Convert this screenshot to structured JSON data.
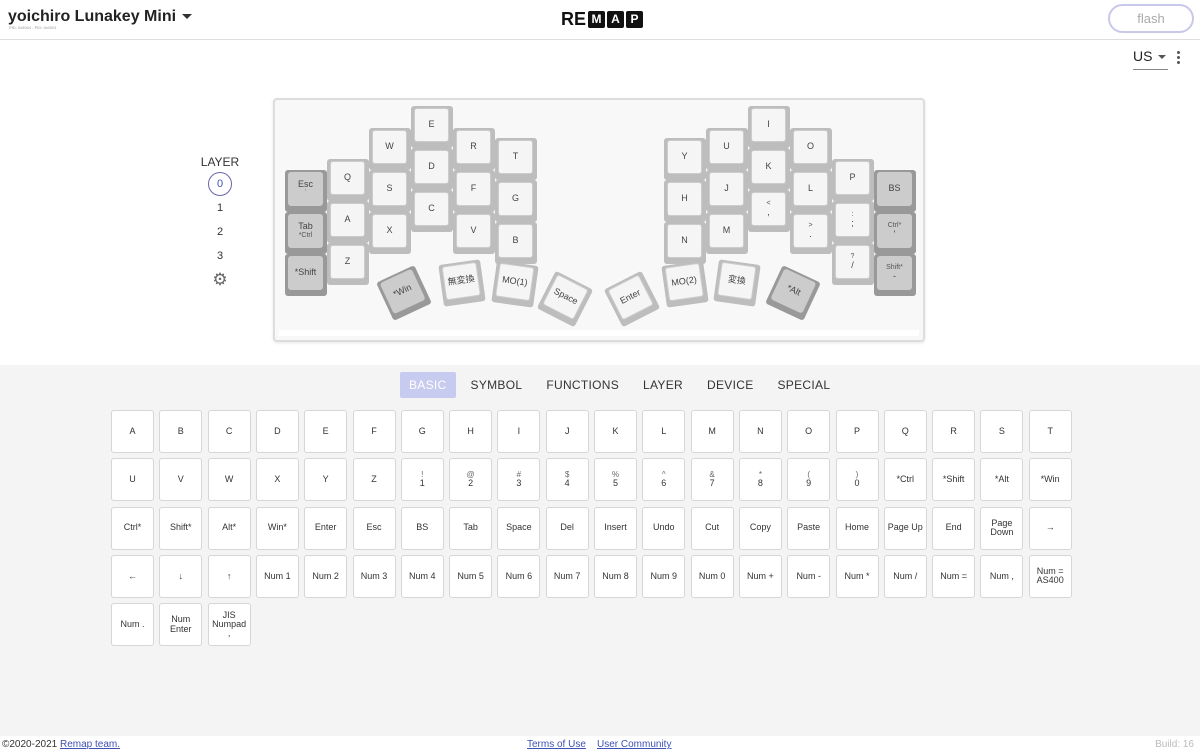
{
  "header": {
    "keyboard_name": "yoichiro Lunakey Mini",
    "ids": "PID: 0x5904 - PID: 0x0001",
    "logo_text": "RE",
    "logo_boxes": [
      "M",
      "A",
      "P"
    ],
    "flash_label": "flash"
  },
  "lang": {
    "value": "US"
  },
  "layer": {
    "title": "LAYER",
    "items": [
      "0",
      "1",
      "2",
      "3"
    ],
    "selected": "0"
  },
  "keymap": [
    {
      "l": "Esc",
      "s": "`",
      "mod": true
    },
    {
      "l": "Tab",
      "s": "*Ctrl",
      "mod": true
    },
    {
      "l": "*Shift",
      "s": "",
      "mod": true
    },
    {
      "l": "Q",
      "s": ""
    },
    {
      "l": "A",
      "s": ""
    },
    {
      "l": "Z",
      "s": ""
    },
    {
      "l": "W",
      "s": ""
    },
    {
      "l": "S",
      "s": ""
    },
    {
      "l": "X",
      "s": ""
    },
    {
      "l": "E",
      "s": ""
    },
    {
      "l": "D",
      "s": ""
    },
    {
      "l": "C",
      "s": ""
    },
    {
      "l": "R",
      "s": ""
    },
    {
      "l": "F",
      "s": ""
    },
    {
      "l": "V",
      "s": ""
    },
    {
      "l": "T",
      "s": ""
    },
    {
      "l": "G",
      "s": ""
    },
    {
      "l": "B",
      "s": ""
    },
    {
      "l": "Y",
      "s": ""
    },
    {
      "l": "H",
      "s": ""
    },
    {
      "l": "N",
      "s": ""
    },
    {
      "l": "U",
      "s": ""
    },
    {
      "l": "J",
      "s": ""
    },
    {
      "l": "M",
      "s": ""
    },
    {
      "l": "I",
      "s": ""
    },
    {
      "l": "K",
      "s": ""
    },
    {
      "l": ",",
      "s": "<"
    },
    {
      "l": "O",
      "s": ""
    },
    {
      "l": "L",
      "s": ""
    },
    {
      "l": ".",
      "s": ">"
    },
    {
      "l": "P",
      "s": ""
    },
    {
      "l": ";",
      "s": ":"
    },
    {
      "l": "/",
      "s": "?"
    },
    {
      "l": "BS",
      "s": "",
      "mod": true
    },
    {
      "l": "'",
      "s": "Ctrl*",
      "mod": true
    },
    {
      "l": "-",
      "s": "Shift*",
      "mod": true
    },
    {
      "l": "*Win",
      "s": "",
      "mod": true
    },
    {
      "l": "無変換",
      "s": ""
    },
    {
      "l": "MO(1)",
      "s": ""
    },
    {
      "l": "Space",
      "s": ""
    },
    {
      "l": "Enter",
      "s": ""
    },
    {
      "l": "MO(2)",
      "s": ""
    },
    {
      "l": "変換",
      "s": ""
    },
    {
      "l": "*Alt",
      "s": "",
      "mod": true
    }
  ],
  "palette": {
    "tabs": [
      "BASIC",
      "SYMBOL",
      "FUNCTIONS",
      "LAYER",
      "DEVICE",
      "SPECIAL"
    ],
    "active_tab": "BASIC",
    "rows": [
      [
        {
          "l": "A"
        },
        {
          "l": "B"
        },
        {
          "l": "C"
        },
        {
          "l": "D"
        },
        {
          "l": "E"
        },
        {
          "l": "F"
        },
        {
          "l": "G"
        },
        {
          "l": "H"
        },
        {
          "l": "I"
        },
        {
          "l": "J"
        },
        {
          "l": "K"
        },
        {
          "l": "L"
        },
        {
          "l": "M"
        },
        {
          "l": "N"
        },
        {
          "l": "O"
        },
        {
          "l": "P"
        },
        {
          "l": "Q"
        },
        {
          "l": "R"
        },
        {
          "l": "S"
        },
        {
          "l": "T"
        }
      ],
      [
        {
          "l": "U"
        },
        {
          "l": "V"
        },
        {
          "l": "W"
        },
        {
          "l": "X"
        },
        {
          "l": "Y"
        },
        {
          "l": "Z"
        },
        {
          "l": "1",
          "s": "!"
        },
        {
          "l": "2",
          "s": "@"
        },
        {
          "l": "3",
          "s": "#"
        },
        {
          "l": "4",
          "s": "$"
        },
        {
          "l": "5",
          "s": "%"
        },
        {
          "l": "6",
          "s": "^"
        },
        {
          "l": "7",
          "s": "&"
        },
        {
          "l": "8",
          "s": "*"
        },
        {
          "l": "9",
          "s": "("
        },
        {
          "l": "0",
          "s": ")"
        },
        {
          "l": "*Ctrl"
        },
        {
          "l": "*Shift"
        },
        {
          "l": "*Alt"
        },
        {
          "l": "*Win"
        }
      ],
      [
        {
          "l": "Ctrl*"
        },
        {
          "l": "Shift*"
        },
        {
          "l": "Alt*"
        },
        {
          "l": "Win*"
        },
        {
          "l": "Enter"
        },
        {
          "l": "Esc"
        },
        {
          "l": "BS"
        },
        {
          "l": "Tab"
        },
        {
          "l": "Space"
        },
        {
          "l": "Del"
        },
        {
          "l": "Insert"
        },
        {
          "l": "Undo"
        },
        {
          "l": "Cut"
        },
        {
          "l": "Copy"
        },
        {
          "l": "Paste"
        },
        {
          "l": "Home"
        },
        {
          "l": "Page Up"
        },
        {
          "l": "End"
        },
        {
          "l": "Page\nDown"
        },
        {
          "l": "→"
        }
      ],
      [
        {
          "l": "←"
        },
        {
          "l": "↓"
        },
        {
          "l": "↑"
        },
        {
          "l": "Num 1"
        },
        {
          "l": "Num 2"
        },
        {
          "l": "Num 3"
        },
        {
          "l": "Num 4"
        },
        {
          "l": "Num 5"
        },
        {
          "l": "Num 6"
        },
        {
          "l": "Num 7"
        },
        {
          "l": "Num 8"
        },
        {
          "l": "Num 9"
        },
        {
          "l": "Num 0"
        },
        {
          "l": "Num +"
        },
        {
          "l": "Num -"
        },
        {
          "l": "Num *"
        },
        {
          "l": "Num /"
        },
        {
          "l": "Num ="
        },
        {
          "l": "Num ,"
        },
        {
          "l": "Num =\nAS400"
        }
      ],
      [
        {
          "l": "Num ."
        },
        {
          "l": "Num\nEnter"
        },
        {
          "l": "JIS\nNumpad\n,"
        }
      ]
    ]
  },
  "footer": {
    "copyright": "©2020-2021",
    "team_link": "Remap team.",
    "terms": "Terms of Use",
    "community": "User Community",
    "build": "Build: 16"
  }
}
